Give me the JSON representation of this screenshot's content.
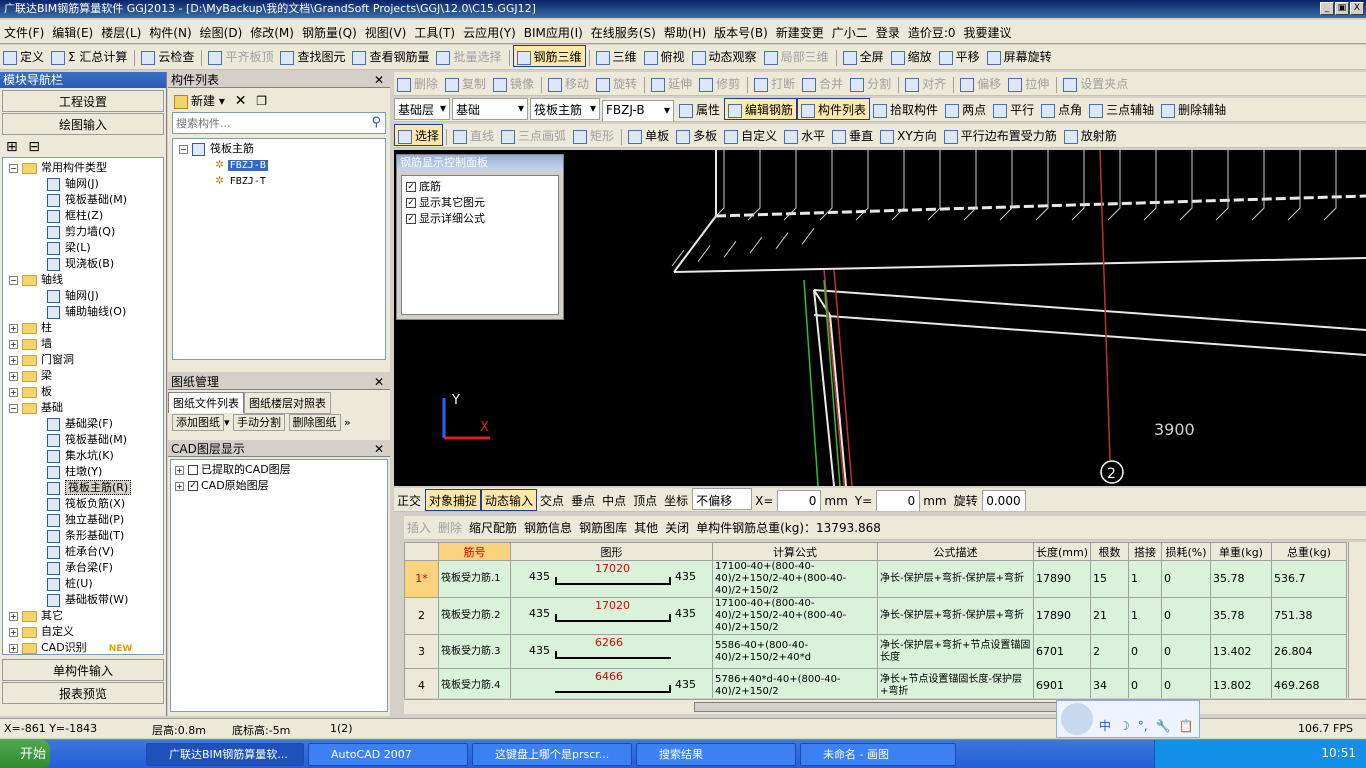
{
  "window": {
    "title": "广联达BIM钢筋算量软件 GGJ2013 - [D:\\MyBackup\\我的文档\\GrandSoft Projects\\GGJ\\12.0\\C15.GGJ12]",
    "min": "_",
    "restore": "▣",
    "close": "X"
  },
  "menu": [
    "文件(F)",
    "编辑(E)",
    "楼层(L)",
    "构件(N)",
    "绘图(D)",
    "修改(M)",
    "钢筋量(Q)",
    "视图(V)",
    "工具(T)",
    "云应用(Y)",
    "BIM应用(I)",
    "在线服务(S)",
    "帮助(H)",
    "版本号(B)",
    "新建变更",
    "广小二",
    "登录",
    "造价豆:0",
    "我要建议"
  ],
  "tb1": [
    "定义",
    "Σ 汇总计算",
    "云检查",
    "平齐板顶",
    "查找图元",
    "查看钢筋量",
    "批量选择",
    "钢筋三维",
    "三维",
    "俯视",
    "动态观察",
    "局部三维",
    "全屏",
    "缩放",
    "平移",
    "屏幕旋转"
  ],
  "tb2": [
    "删除",
    "复制",
    "镜像",
    "移动",
    "旋转",
    "延伸",
    "修剪",
    "打断",
    "合并",
    "分割",
    "对齐",
    "偏移",
    "拉伸",
    "设置夹点"
  ],
  "tb3": {
    "floor": "基础层",
    "type": "基础",
    "sub": "筏板主筋",
    "comp": "FBZJ-B",
    "items": [
      "属性",
      "编辑钢筋",
      "构件列表",
      "拾取构件",
      "两点",
      "平行",
      "点角",
      "三点辅轴",
      "删除辅轴"
    ]
  },
  "tb4": [
    "选择",
    "直线",
    "三点画弧",
    "矩形",
    "单板",
    "多板",
    "自定义",
    "水平",
    "垂直",
    "XY方向",
    "平行边布置受力筋",
    "放射筋"
  ],
  "nav": {
    "title": "模块导航栏",
    "btn1": "工程设置",
    "btn2": "绘图输入",
    "bottom1": "单构件输入",
    "bottom2": "报表预览",
    "tree": [
      {
        "lvl": 0,
        "exp": "-",
        "folder": true,
        "label": "常用构件类型"
      },
      {
        "lvl": 1,
        "label": "轴网(J)"
      },
      {
        "lvl": 1,
        "label": "筏板基础(M)"
      },
      {
        "lvl": 1,
        "label": "框柱(Z)"
      },
      {
        "lvl": 1,
        "label": "剪力墙(Q)"
      },
      {
        "lvl": 1,
        "label": "梁(L)"
      },
      {
        "lvl": 1,
        "label": "现浇板(B)"
      },
      {
        "lvl": 0,
        "exp": "-",
        "folder": true,
        "label": "轴线"
      },
      {
        "lvl": 1,
        "label": "轴网(J)"
      },
      {
        "lvl": 1,
        "label": "辅助轴线(O)"
      },
      {
        "lvl": 0,
        "exp": "+",
        "folder": true,
        "label": "柱"
      },
      {
        "lvl": 0,
        "exp": "+",
        "folder": true,
        "label": "墙"
      },
      {
        "lvl": 0,
        "exp": "+",
        "folder": true,
        "label": "门窗洞"
      },
      {
        "lvl": 0,
        "exp": "+",
        "folder": true,
        "label": "梁"
      },
      {
        "lvl": 0,
        "exp": "+",
        "folder": true,
        "label": "板"
      },
      {
        "lvl": 0,
        "exp": "-",
        "folder": true,
        "label": "基础"
      },
      {
        "lvl": 1,
        "label": "基础梁(F)"
      },
      {
        "lvl": 1,
        "label": "筏板基础(M)"
      },
      {
        "lvl": 1,
        "label": "集水坑(K)"
      },
      {
        "lvl": 1,
        "label": "柱墩(Y)"
      },
      {
        "lvl": 1,
        "label": "筏板主筋(R)",
        "sel": true
      },
      {
        "lvl": 1,
        "label": "筏板负筋(X)"
      },
      {
        "lvl": 1,
        "label": "独立基础(P)"
      },
      {
        "lvl": 1,
        "label": "条形基础(T)"
      },
      {
        "lvl": 1,
        "label": "桩承台(V)"
      },
      {
        "lvl": 1,
        "label": "承台梁(F)"
      },
      {
        "lvl": 1,
        "label": "桩(U)"
      },
      {
        "lvl": 1,
        "label": "基础板带(W)"
      },
      {
        "lvl": 0,
        "exp": "+",
        "folder": true,
        "label": "其它"
      },
      {
        "lvl": 0,
        "exp": "+",
        "folder": true,
        "label": "自定义"
      },
      {
        "lvl": 0,
        "exp": "+",
        "folder": true,
        "label": "CAD识别",
        "badge": "NEW"
      }
    ]
  },
  "complist": {
    "title": "构件列表",
    "new": "新建",
    "search_ph": "搜索构件...",
    "root": "筏板主筋",
    "items": [
      "FBZJ-B",
      "FBZJ-T"
    ]
  },
  "drawing": {
    "title": "图纸管理",
    "tab1": "图纸文件列表",
    "tab2": "图纸楼层对照表",
    "b1": "添加图纸",
    "b2": "手动分割",
    "b3": "删除图纸"
  },
  "cad": {
    "title": "CAD图层显示",
    "l1": "已提取的CAD图层",
    "l2": "CAD原始图层"
  },
  "rebarpanel": {
    "title": "钢筋显示控制面板",
    "c1": "底筋",
    "c2": "显示其它图元",
    "c3": "显示详细公式"
  },
  "canvas": {
    "dim": "3900",
    "axis": "2",
    "ax_x": "X",
    "ax_y": "Y"
  },
  "snapbar": [
    "正交",
    "对象捕捉",
    "动态输入",
    "交点",
    "垂点",
    "中点",
    "顶点",
    "坐标",
    "不偏移",
    "X=",
    "0",
    "mm",
    "Y=",
    "0",
    "mm",
    "旋转",
    "0.000"
  ],
  "gridbar": [
    "插入",
    "删除",
    "缩尺配筋",
    "钢筋信息",
    "钢筋图库",
    "其他",
    "关闭",
    "单构件钢筋总重(kg)：13793.868"
  ],
  "table": {
    "headers": [
      "筋号",
      "图形",
      "计算公式",
      "公式描述",
      "长度(mm)",
      "根数",
      "搭接",
      "损耗(%)",
      "单重(kg)",
      "总重(kg)"
    ],
    "rows": [
      {
        "rn": "1*",
        "name": "筏板受力筋.1",
        "l": "435",
        "m": "17020",
        "r": "435",
        "f": "17100-40+(800-40-40)/2+150/2-40+(800-40-40)/2+150/2",
        "d": "净长-保护层+弯折-保护层+弯折",
        "len": "17890",
        "n": "15",
        "lap": "1",
        "loss": "0",
        "uw": "35.78",
        "tw": "536.7"
      },
      {
        "rn": "2",
        "name": "筏板受力筋.2",
        "l": "435",
        "m": "17020",
        "r": "435",
        "f": "17100-40+(800-40-40)/2+150/2-40+(800-40-40)/2+150/2",
        "d": "净长-保护层+弯折-保护层+弯折",
        "len": "17890",
        "n": "21",
        "lap": "1",
        "loss": "0",
        "uw": "35.78",
        "tw": "751.38"
      },
      {
        "rn": "3",
        "name": "筏板受力筋.3",
        "l": "435",
        "m": "6266",
        "r": "",
        "f": "5586-40+(800-40-40)/2+150/2+40*d",
        "d": "净长-保护层+弯折+节点设置锚固长度",
        "len": "6701",
        "n": "2",
        "lap": "0",
        "loss": "0",
        "uw": "13.402",
        "tw": "26.804"
      },
      {
        "rn": "4",
        "name": "筏板受力筋.4",
        "l": "",
        "m": "6466",
        "r": "435",
        "f": "5786+40*d-40+(800-40-40)/2+150/2",
        "d": "净长+节点设置锚固长度-保护层+弯折",
        "len": "6901",
        "n": "34",
        "lap": "0",
        "loss": "0",
        "uw": "13.802",
        "tw": "469.268"
      }
    ]
  },
  "status": {
    "coord": "X=-861 Y=-1843",
    "floor_h": "层高:0.8m",
    "bottom_h": "底标高:-5m",
    "count": "1(2)",
    "fps": "106.7 FPS"
  },
  "ime": [
    "中",
    "☽",
    "°,",
    "🔧",
    "📋"
  ],
  "taskbar": {
    "start": "开始",
    "tasks": [
      "广联达BIM钢筋算量软...",
      "AutoCAD 2007",
      "这键盘上哪个是prscr...",
      "搜索结果",
      "未命名 - 画图"
    ],
    "time": "10:51"
  }
}
